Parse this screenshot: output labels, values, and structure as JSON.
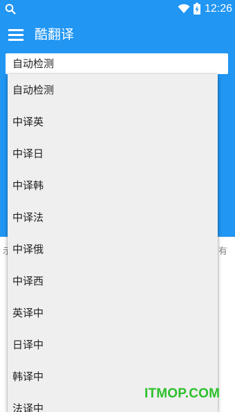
{
  "status_bar": {
    "time": "12:26",
    "icons": [
      "search-icon",
      "wifi-icon",
      "battery-charging-icon"
    ]
  },
  "app_bar": {
    "title": "酷翻译",
    "menu_icon": "menu-icon"
  },
  "language_select": {
    "selected": "自动检测"
  },
  "dropdown": {
    "options": [
      "自动检测",
      "中译英",
      "中译日",
      "中译韩",
      "中译法",
      "中译俄",
      "中译西",
      "英译中",
      "日译中",
      "韩译中",
      "法译中"
    ]
  },
  "background_partial_text": {
    "left": "示",
    "right": "有"
  },
  "watermark": "ITMOP.COM",
  "colors": {
    "primary": "#2196f3",
    "dropdown_bg": "#efefef",
    "watermark": "#2cc02c"
  }
}
